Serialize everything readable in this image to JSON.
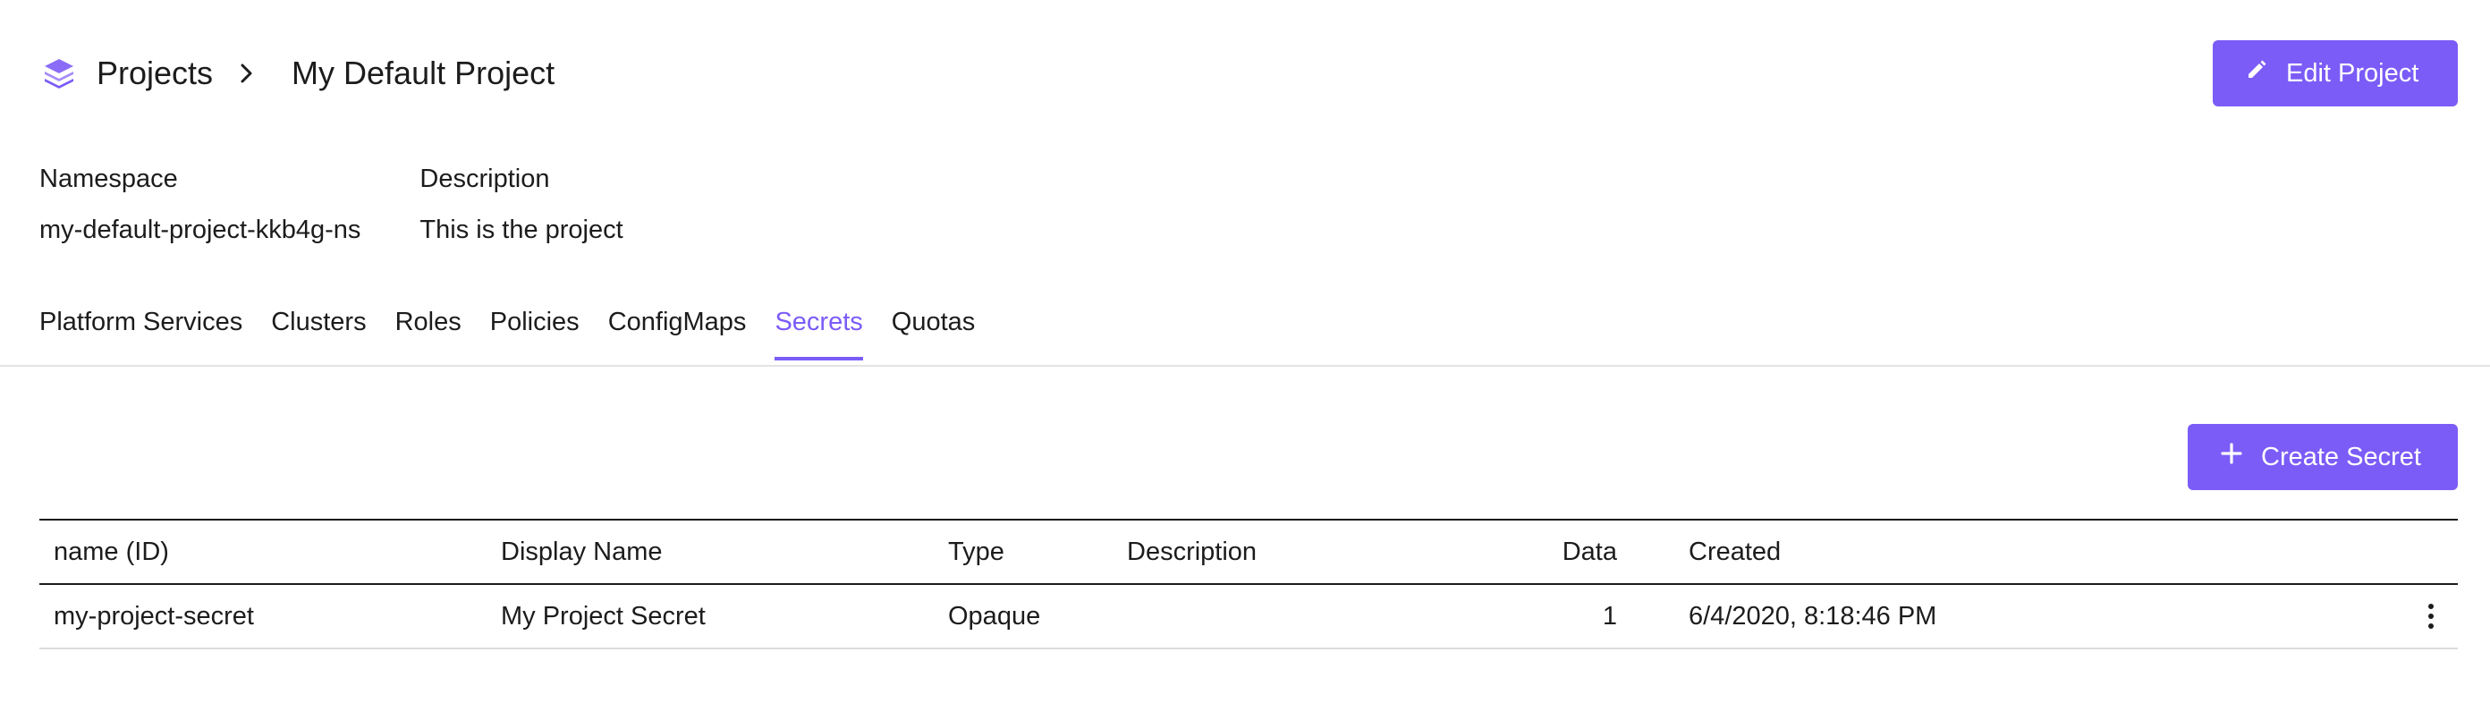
{
  "header": {
    "breadcrumb_root": "Projects",
    "breadcrumb_current": "My Default Project",
    "edit_button_label": "Edit Project",
    "logo_icon": "stacked-layers-icon"
  },
  "meta": {
    "namespace_label": "Namespace",
    "namespace_value": "my-default-project-kkb4g-ns",
    "description_label": "Description",
    "description_value": "This is the project"
  },
  "tabs": [
    {
      "label": "Platform Services",
      "active": false
    },
    {
      "label": "Clusters",
      "active": false
    },
    {
      "label": "Roles",
      "active": false
    },
    {
      "label": "Policies",
      "active": false
    },
    {
      "label": "ConfigMaps",
      "active": false
    },
    {
      "label": "Secrets",
      "active": true
    },
    {
      "label": "Quotas",
      "active": false
    }
  ],
  "actions": {
    "create_button_label": "Create Secret"
  },
  "table": {
    "columns": [
      "name (ID)",
      "Display Name",
      "Type",
      "Description",
      "Data",
      "Created"
    ],
    "rows": [
      {
        "name": "my-project-secret",
        "display_name": "My Project Secret",
        "type": "Opaque",
        "description": "",
        "data": "1",
        "created": "6/4/2020, 8:18:46 PM"
      }
    ]
  },
  "colors": {
    "accent": "#7c5cf6",
    "text": "#1c1c1c",
    "divider": "#e3e3e3"
  }
}
